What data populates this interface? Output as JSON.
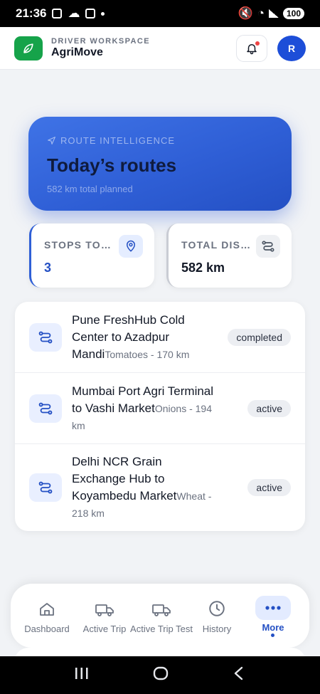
{
  "status_bar": {
    "time": "21:36",
    "battery": "100"
  },
  "header": {
    "eyebrow": "DRIVER WORKSPACE",
    "app_name": "AgriMove",
    "avatar_initial": "R"
  },
  "hero": {
    "eyebrow": "ROUTE INTELLIGENCE",
    "title": "Today’s routes",
    "subtitle": "582 km total planned"
  },
  "stats": [
    {
      "label": "STOPS TOD...",
      "value": "3",
      "icon": "map-pin-icon"
    },
    {
      "label": "TOTAL DIST...",
      "value": "582 km",
      "icon": "route-icon"
    }
  ],
  "routes": [
    {
      "title": "Pune FreshHub Cold Center to Azadpur Mandi",
      "meta": "Tomatoes - 170 km",
      "status": "completed"
    },
    {
      "title": "Mumbai Port Agri Terminal to Vashi Market",
      "meta": "Onions - 194 km",
      "status": "active"
    },
    {
      "title": "Delhi NCR Grain Exchange Hub to Koyambedu Market",
      "meta": "Wheat - 218 km",
      "status": "active"
    }
  ],
  "nav": [
    {
      "label": "Dashboard",
      "icon": "home-icon"
    },
    {
      "label": "Active Trip",
      "icon": "truck-icon"
    },
    {
      "label": "Active Trip Test",
      "icon": "truck-icon"
    },
    {
      "label": "History",
      "icon": "clock-icon"
    },
    {
      "label": "More",
      "icon": "more-icon",
      "active": true
    }
  ],
  "colors": {
    "accent": "#2f5fd6",
    "brand_green": "#16a34a",
    "badge_bg": "#eceef2"
  }
}
